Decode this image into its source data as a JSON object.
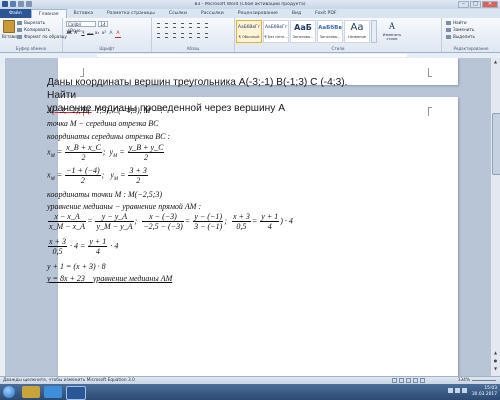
{
  "window": {
    "title": "В3 - Microsoft Word (Сбой активации продукта)",
    "controls": [
      "–",
      "□",
      "✕"
    ]
  },
  "tabs": [
    "Файл",
    "Главная",
    "Вставка",
    "Разметка страницы",
    "Ссылки",
    "Рассылки",
    "Рецензирование",
    "Вид",
    "Foxit PDF"
  ],
  "ribbon": {
    "clipboard": {
      "paste": "Вставить",
      "cut": "Вырезать",
      "copy": "Копировать",
      "format_painter": "Формат по образцу",
      "label": "Буфер обмена"
    },
    "font": {
      "name": "Calibri (Осно",
      "size": "14",
      "label": "Шрифт",
      "buttons": [
        "Ж",
        "К",
        "Ч",
        "abc",
        "x₂",
        "x²",
        "A",
        "A"
      ]
    },
    "paragraph": {
      "label": "Абзац"
    },
    "styles": {
      "label": "Стили",
      "items": [
        {
          "preview": "АаБбВвГг",
          "name": "¶ Обычный"
        },
        {
          "preview": "АаБбВвГг",
          "name": "¶ Без инте..."
        },
        {
          "preview": "АаБ",
          "name": "Заголово..."
        },
        {
          "preview": "АаБбВв",
          "name": "Заголово..."
        },
        {
          "preview": "Аа",
          "name": "Название"
        }
      ],
      "change": "Изменить стили"
    },
    "editing": {
      "find": "Найти",
      "replace": "Заменить",
      "select": "Выделить",
      "label": "Редактирование"
    }
  },
  "document": {
    "task_line1": "Даны координаты вершин треугольника А(-3;-1) В(-1;3) С (-4;3). Найти",
    "task_line2_underlined": "уранение",
    "task_line2_rest": " медианы проведенной через вершину А",
    "math": {
      "l1": "A(−3;−1), B(−1;3), C(−4;3), M − ?",
      "l2": "точка M − середина отрезка BC",
      "l3": "координаты середины отрезка BC :",
      "l4_xm": "x",
      "l4_xm_sub": "M",
      "l4_num1": "x_B + x_C",
      "l4_den": "2",
      "l4_ym": "y",
      "l4_num2": "y_B + y_C",
      "l5_num1": "−1 + (−4)",
      "l5_num2": "3 + 3",
      "l6": "координаты точки M :   M(−2,5;3)",
      "l7": "уравнение медианы −  уравнение прямой AM :",
      "l8_a_num": "x − x_A",
      "l8_a_den": "x_M − x_A",
      "l8_b_num": "y − y_A",
      "l8_b_den": "y_M − y_A",
      "l8_c_num": "x − (−3)",
      "l8_c_den": "−2,5 − (−3)",
      "l8_d_num": "y − (−1)",
      "l8_d_den": "3 − (−1)",
      "l8_e_num": "x + 3",
      "l8_e_den": "0,5",
      "l8_f_num": "y + 1",
      "l8_f_den": "4",
      "l8_tail": ") · 4",
      "l9_num": "x + 3",
      "l9_den": "0,5",
      "l9_mid": " · 4 = ",
      "l9_num2": "y + 1",
      "l9_den2": "4",
      "l9_tail": " · 4",
      "l10": "y + 1 = (x + 3) · 8",
      "l11": "y = 8x + 23",
      "l11_note": "уравнение медианы AM"
    }
  },
  "status": {
    "hint": "Дважды щелкните, чтобы изменить Microsoft Equation 3.0",
    "zoom": "134%"
  },
  "tray": {
    "time": "15:03",
    "date": "30.03.2017"
  },
  "colors": {
    "file_tab": "#2b5797",
    "ribbon": "#dfe7f1",
    "workspace": "#b8c5d6",
    "taskbar": "#2c4a72"
  }
}
